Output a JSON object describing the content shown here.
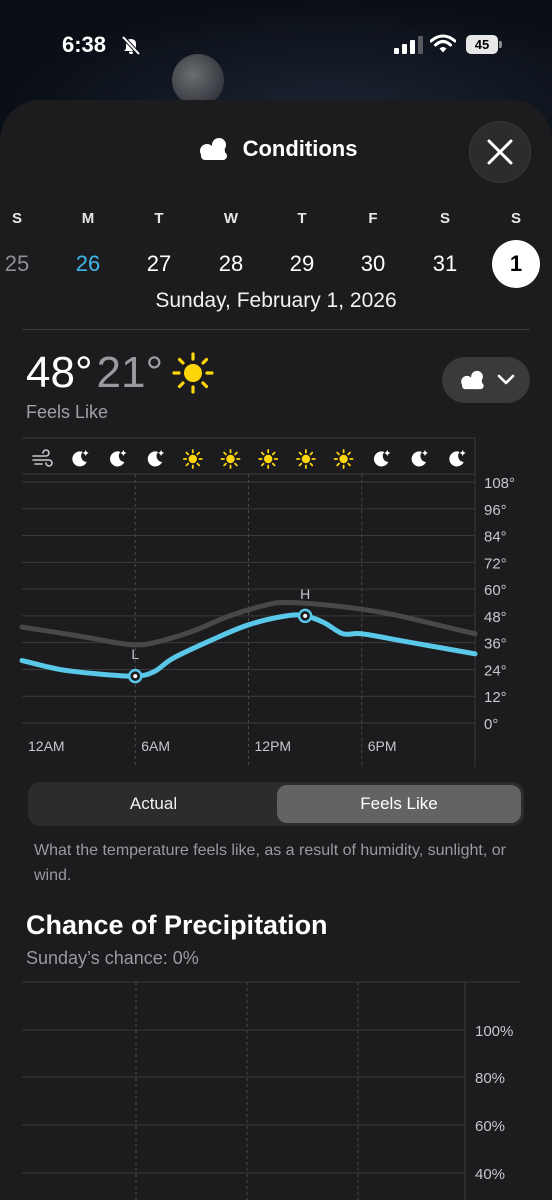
{
  "status_bar": {
    "time": "6:38",
    "battery": "45"
  },
  "sheet": {
    "title": "Conditions"
  },
  "week": {
    "days": [
      {
        "letter": "S",
        "number": "25",
        "state": "past"
      },
      {
        "letter": "M",
        "number": "26",
        "state": "today"
      },
      {
        "letter": "T",
        "number": "27",
        "state": "future"
      },
      {
        "letter": "W",
        "number": "28",
        "state": "future"
      },
      {
        "letter": "T",
        "number": "29",
        "state": "future"
      },
      {
        "letter": "F",
        "number": "30",
        "state": "future"
      },
      {
        "letter": "S",
        "number": "31",
        "state": "future"
      },
      {
        "letter": "S",
        "number": "1",
        "state": "selected"
      }
    ],
    "selected_date": "Sunday, February 1, 2026"
  },
  "summary": {
    "high": "48°",
    "low": "21°",
    "label": "Feels Like",
    "condition_icon": "sun-icon"
  },
  "chart_data": [
    {
      "type": "line",
      "x_labels": [
        "12AM",
        "6AM",
        "12PM",
        "6PM"
      ],
      "y_ticks": [
        "108°",
        "96°",
        "84°",
        "72°",
        "60°",
        "48°",
        "36°",
        "24°",
        "12°",
        "0°"
      ],
      "ylim": [
        0,
        108
      ],
      "hour_icons": [
        "wind-icon",
        "moon-icon",
        "moon-icon",
        "moon-icon",
        "sun-icon",
        "sun-icon",
        "sun-icon",
        "sun-icon",
        "sun-icon",
        "moon-icon",
        "moon-icon",
        "moon-icon"
      ],
      "series": [
        {
          "role": "actual",
          "color": "#48484a",
          "x": [
            0,
            3,
            5,
            6,
            7,
            9,
            11,
            13,
            14,
            16,
            18,
            20,
            22,
            24
          ],
          "values": [
            43,
            39,
            36,
            35,
            36,
            41,
            48,
            53,
            54,
            53,
            51,
            48,
            44,
            40
          ]
        },
        {
          "role": "feels_like",
          "color": "#5ac8e8",
          "x": [
            0,
            2,
            4,
            6,
            7,
            8,
            10,
            12,
            14,
            15,
            16,
            17,
            18,
            20,
            22,
            24
          ],
          "values": [
            28,
            24,
            22,
            21,
            23,
            29,
            37,
            44,
            48,
            48,
            45,
            40,
            40,
            37,
            34,
            31
          ]
        }
      ],
      "markers": [
        {
          "label": "L",
          "x": 6,
          "value": 21
        },
        {
          "label": "H",
          "x": 15,
          "value": 48
        }
      ]
    },
    {
      "type": "line",
      "y_ticks": [
        "100%",
        "80%",
        "60%",
        "40%"
      ],
      "ylim": [
        0,
        100
      ],
      "series": []
    }
  ],
  "toggle": {
    "options": [
      "Actual",
      "Feels Like"
    ],
    "selected": "Feels Like"
  },
  "explanation": "What the temperature feels like, as a result of humidity, sunlight, or wind.",
  "precipitation": {
    "title": "Chance of Precipitation",
    "subtitle": "Sunday’s chance: 0%"
  }
}
